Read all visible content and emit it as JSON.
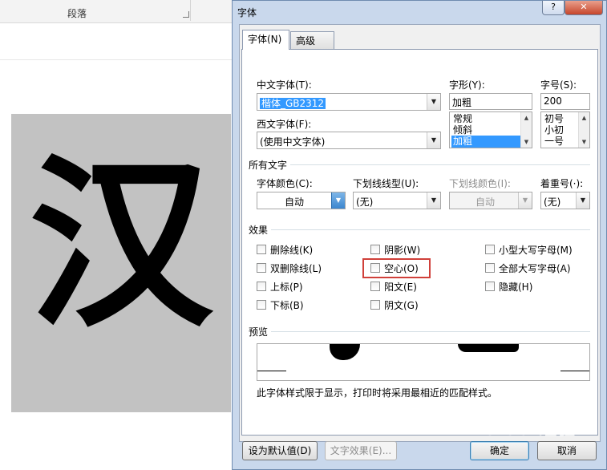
{
  "background": {
    "ribbon_group_label": "段落",
    "doc_char": "汉"
  },
  "dialog": {
    "title": "字体",
    "help_label": "?",
    "close_label": "✕",
    "tabs": [
      {
        "label": "字体(N)",
        "active": true
      },
      {
        "label": "高级(V)",
        "active": false
      }
    ],
    "chinese_font": {
      "label": "中文字体(T):",
      "value": "楷体_GB2312"
    },
    "western_font": {
      "label": "西文字体(F):",
      "value": "(使用中文字体)"
    },
    "style": {
      "label": "字形(Y):",
      "value": "加粗",
      "options": [
        "常规",
        "倾斜",
        "加粗"
      ],
      "selected": "加粗"
    },
    "size": {
      "label": "字号(S):",
      "value": "200",
      "options": [
        "初号",
        "小初",
        "一号"
      ]
    },
    "all_text": {
      "heading": "所有文字",
      "font_color": {
        "label": "字体颜色(C):",
        "value": "自动"
      },
      "underline_style": {
        "label": "下划线线型(U):",
        "value": "(无)"
      },
      "underline_color": {
        "label": "下划线颜色(I):",
        "value": "自动"
      },
      "emphasis": {
        "label": "着重号(·):",
        "value": "(无)"
      }
    },
    "effects": {
      "heading": "效果",
      "options": [
        {
          "label": "删除线(K)",
          "checked": false
        },
        {
          "label": "阴影(W)",
          "checked": false
        },
        {
          "label": "小型大写字母(M)",
          "checked": false
        },
        {
          "label": "双删除线(L)",
          "checked": false
        },
        {
          "label": "空心(O)",
          "checked": false
        },
        {
          "label": "全部大写字母(A)",
          "checked": false
        },
        {
          "label": "上标(P)",
          "checked": false
        },
        {
          "label": "阳文(E)",
          "checked": false
        },
        {
          "label": "隐藏(H)",
          "checked": false
        },
        {
          "label": "下标(B)",
          "checked": false
        },
        {
          "label": "阴文(G)",
          "checked": false
        }
      ]
    },
    "preview": {
      "heading": "预览",
      "note": "此字体样式限于显示，打印时将采用最相近的匹配样式。"
    },
    "buttons": {
      "set_default": "设为默认值(D)",
      "text_effects": "文字效果(E)...",
      "ok": "确定",
      "cancel": "取消"
    }
  },
  "watermark": "Baidu 经验",
  "colors": {
    "selection": "#3399ff",
    "highlight_box": "#d0403a",
    "dialog_frame": "#c9d8ec"
  }
}
